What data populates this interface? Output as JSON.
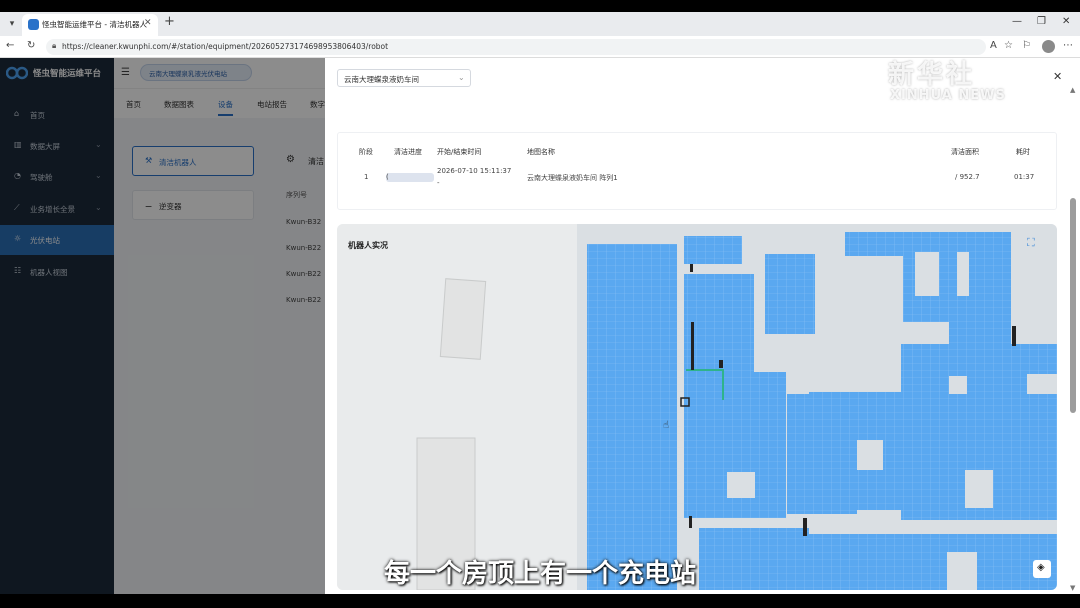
{
  "browser": {
    "tab_title": "怪虫智能运维平台 - 清洁机器人",
    "url": "https://cleaner.kwunphi.com/#/station/equipment/2026052731746989538064​03/robot"
  },
  "sidebar": {
    "brand": "怪虫智能运维平台",
    "items": [
      {
        "label": "首页",
        "icon": "home-icon"
      },
      {
        "label": "数据大屏",
        "icon": "dashboard-icon"
      },
      {
        "label": "驾驶舱",
        "icon": "cockpit-icon"
      },
      {
        "label": "业务增长全景",
        "icon": "chart-icon"
      },
      {
        "label": "光伏电站",
        "icon": "solar-icon"
      },
      {
        "label": "机器人视图",
        "icon": "robot-icon"
      }
    ]
  },
  "main": {
    "station": "云南大理蝶泉乳液光伏电站",
    "tabs": [
      "首页",
      "数据图表",
      "设备",
      "电站报告",
      "数字"
    ],
    "subitems": [
      "清洁机器人",
      "逆变器"
    ],
    "panel_title": "清洁",
    "serial_header": "序列号",
    "serials": [
      "Kwun-B32",
      "Kwun-B22",
      "Kwun-B22",
      "Kwun-B22"
    ]
  },
  "drawer": {
    "select_value": "云南大理蝶泉液奶车间",
    "table": {
      "headers": [
        "阶段",
        "清洁进度",
        "开始/结束时间",
        "地图名称",
        "清洁面积",
        "耗时"
      ],
      "row": {
        "stage": "1",
        "progress_prefix": "(",
        "time_start": "2026-07-10 15:11:37",
        "time_end": "-",
        "map_name": "云南大理蝶泉液奶车间 阵列1",
        "area": "/ 952.7",
        "duration": "01:37"
      }
    },
    "map_title": "机器人实况"
  },
  "overlay": {
    "watermark_cn": "新华社",
    "watermark_en": "XINHUA NEWS",
    "subtitle": "每一个房顶上有一个充电站"
  },
  "colors": {
    "panel": "#5aa8f0",
    "sidebar": "#1c2a3b",
    "accent": "#2a72c9"
  }
}
